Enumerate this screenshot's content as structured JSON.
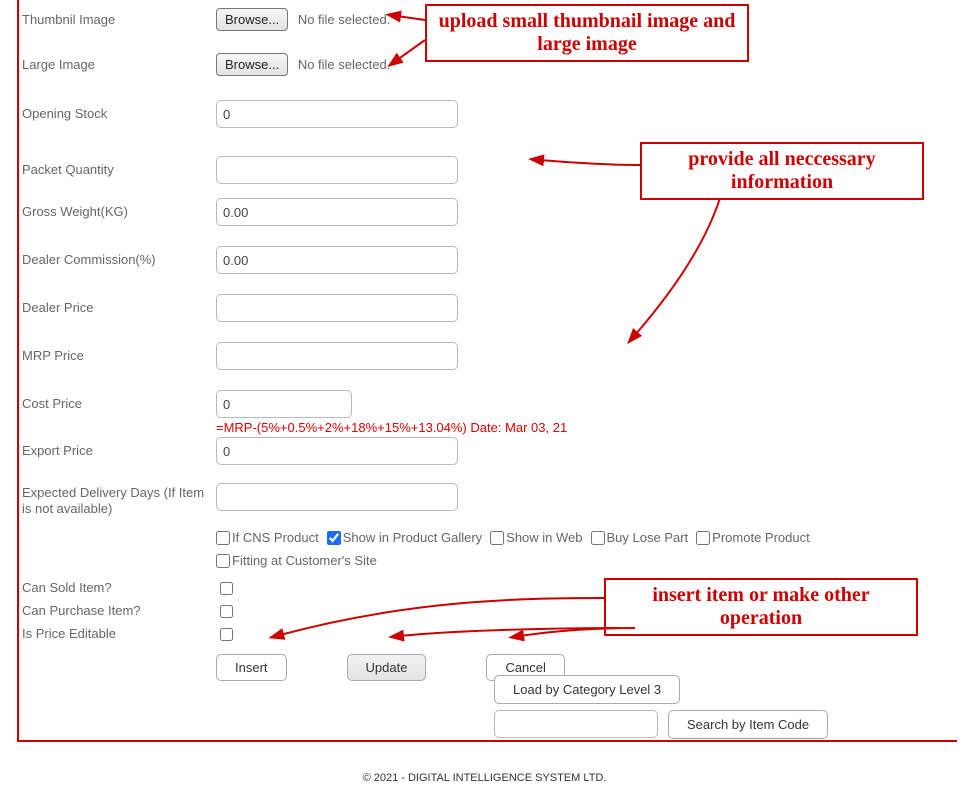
{
  "labels": {
    "thumbnail": "Thumbnil Image",
    "large": "Large Image",
    "opening_stock": "Opening Stock",
    "packet_qty": "Packet Quantity",
    "gross_weight": "Gross Weight(KG)",
    "dealer_comm": "Dealer Commission(%)",
    "dealer_price": "Dealer Price",
    "mrp": "MRP Price",
    "cost": "Cost Price",
    "export": "Export Price",
    "expected": "Expected Delivery Days (If  Item is not available)",
    "can_sold": "Can Sold Item?",
    "can_purchase": "Can Purchase Item?",
    "price_editable": "Is Price Editable"
  },
  "file": {
    "browse": "Browse...",
    "none": "No file selected."
  },
  "values": {
    "opening_stock": "0",
    "packet_qty": "",
    "gross_weight": "0.00",
    "dealer_comm": "0.00",
    "dealer_price": "",
    "mrp": "",
    "cost": "0",
    "export": "0",
    "expected": ""
  },
  "cost_note": "=MRP-(5%+0.5%+2%+18%+15%+13.04%) Date: Mar 03, 21",
  "checks": {
    "cns": "If CNS Product",
    "gallery": "Show in Product Gallery",
    "web": "Show in Web",
    "lose": "Buy Lose Part",
    "promote": "Promote Product",
    "fitting": "Fitting at Customer's Site"
  },
  "buttons": {
    "insert": "Insert",
    "update": "Update",
    "cancel": "Cancel",
    "load_cat": "Load by Category Level 3",
    "search_code": "Search by Item Code"
  },
  "callouts": {
    "upload": "upload small thumbnail image and large image",
    "info": "provide all neccessary information",
    "ops": "insert item or make other operation"
  },
  "footer": "© 2021 - DIGITAL INTELLIGENCE SYSTEM LTD."
}
